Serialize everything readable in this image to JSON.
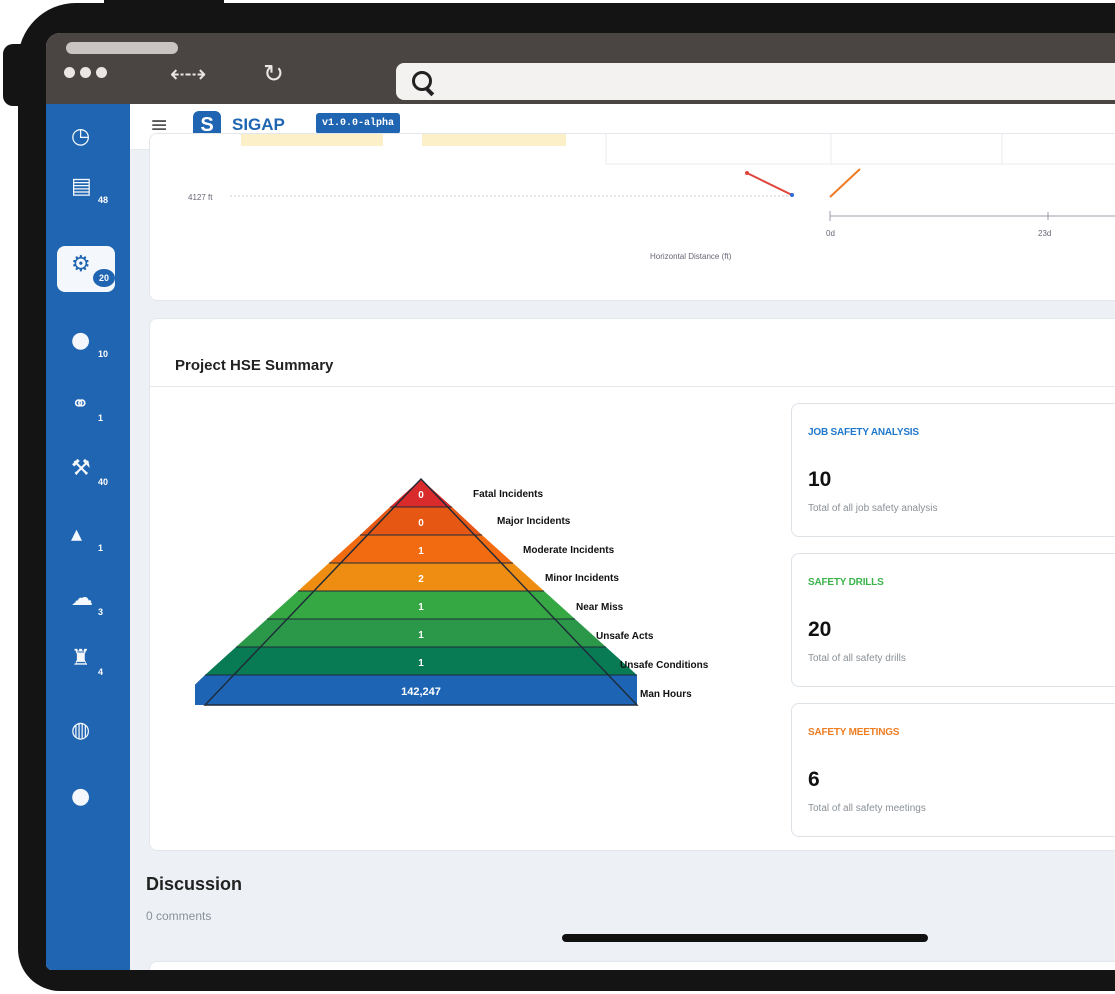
{
  "browser": {
    "pill": "",
    "nav_arrows": "⇠⇢",
    "reload_icon": "↻",
    "url": ""
  },
  "topbar": {
    "menu_icon": "≡",
    "logo_glyph": "S",
    "brand": "SIGAP",
    "version": "v1.0.0-alpha"
  },
  "sidebar": {
    "items": [
      {
        "icon": "gauge-icon",
        "glyph": "◷",
        "count": ""
      },
      {
        "icon": "document-icon",
        "glyph": "▤",
        "count": "48"
      },
      {
        "icon": "gears-icon",
        "glyph": "⚙",
        "count": "20"
      },
      {
        "icon": "drop-icon",
        "glyph": "●",
        "count": "10"
      },
      {
        "icon": "handshake-icon",
        "glyph": "⚭",
        "count": "1"
      },
      {
        "icon": "oil-pump-icon",
        "glyph": "⚒",
        "count": "40"
      },
      {
        "icon": "map-region-icon",
        "glyph": "▴",
        "count": "1"
      },
      {
        "icon": "island-icon",
        "glyph": "☁",
        "count": "3"
      },
      {
        "icon": "facility-icon",
        "glyph": "♜",
        "count": "4"
      },
      {
        "icon": "globe-icon",
        "glyph": "◍",
        "count": ""
      },
      {
        "icon": "chat-icon",
        "glyph": "●",
        "count": ""
      }
    ]
  },
  "chart": {
    "y_tick": "4127 ft",
    "x_ticks": [
      "0d",
      "23d"
    ],
    "x_label": "Horizontal Distance (ft)"
  },
  "summary": {
    "title": "Project HSE Summary",
    "pyramid": [
      {
        "value": "0",
        "label": "Fatal Incidents",
        "color": "#d92b2b"
      },
      {
        "value": "0",
        "label": "Major Incidents",
        "color": "#e55713"
      },
      {
        "value": "1",
        "label": "Moderate Incidents",
        "color": "#f26b10"
      },
      {
        "value": "2",
        "label": "Minor Incidents",
        "color": "#ef8d12"
      },
      {
        "value": "1",
        "label": "Near Miss",
        "color": "#35a843"
      },
      {
        "value": "1",
        "label": "Unsafe Acts",
        "color": "#2b9849"
      },
      {
        "value": "1",
        "label": "Unsafe Conditions",
        "color": "#087a54"
      },
      {
        "value": "142,247",
        "label": "Man Hours",
        "color": "#1e64b4"
      }
    ],
    "stats": [
      {
        "label": "JOB SAFETY ANALYSIS",
        "value": "10",
        "desc": "Total of all job safety analysis",
        "color": "#1f78cc"
      },
      {
        "label": "SAFETY DRILLS",
        "value": "20",
        "desc": "Total of all safety drills",
        "color": "#3bb34b"
      },
      {
        "label": "SAFETY MEETINGS",
        "value": "6",
        "desc": "Total of all safety meetings",
        "color": "#ef7d22"
      }
    ]
  },
  "discussion": {
    "title": "Discussion",
    "count": "0 comments"
  }
}
